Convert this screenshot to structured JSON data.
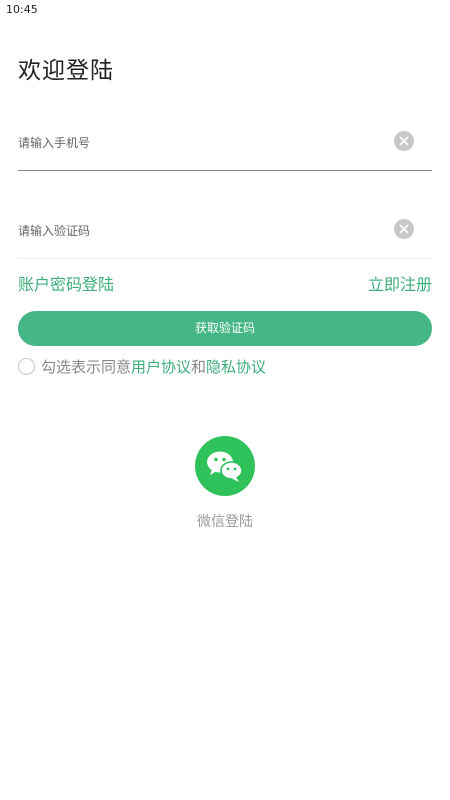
{
  "status_bar": {
    "time": "10:45"
  },
  "page": {
    "title": "欢迎登陆"
  },
  "phone_field": {
    "placeholder": "请输入手机号",
    "value": ""
  },
  "code_field": {
    "placeholder": "请输入验证码",
    "value": ""
  },
  "links": {
    "password_login": "账户密码登陆",
    "register": "立即注册"
  },
  "primary_button": {
    "label": "获取验证码"
  },
  "agreement": {
    "checked": false,
    "prefix": "勾选表示同意",
    "user_agreement": "用户协议",
    "conjunction": "和",
    "privacy_policy": "隐私协议"
  },
  "wechat_login": {
    "icon": "wechat-icon",
    "label": "微信登陆"
  },
  "colors": {
    "accent": "#3dae7a",
    "button": "#45b685",
    "wechat": "#2fc25b",
    "clear_icon": "#c8c8c8"
  }
}
